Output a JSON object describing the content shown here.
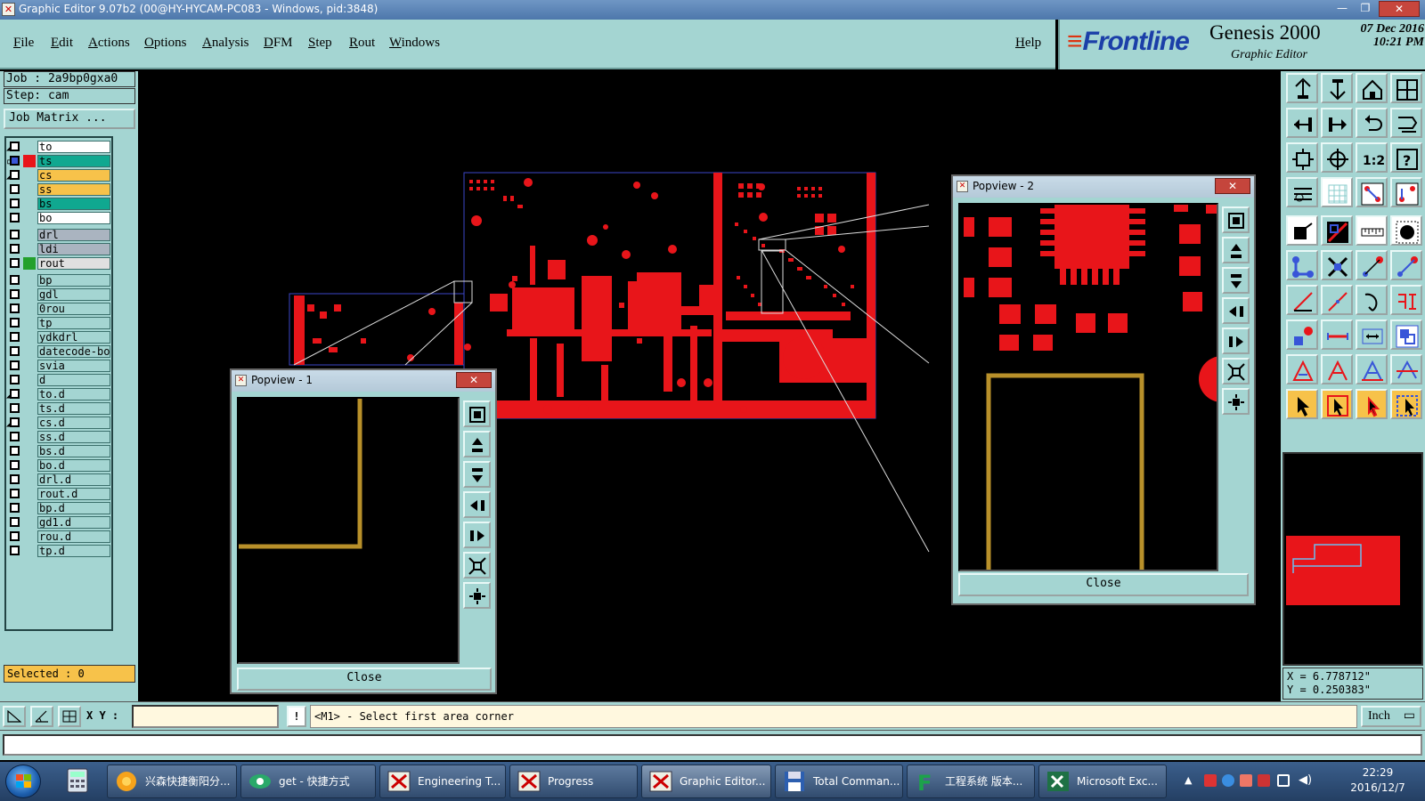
{
  "window": {
    "title": "Graphic Editor 9.07b2 (00@HY-HYCAM-PC083 - Windows, pid:3848)",
    "min": "—",
    "max": "❐",
    "close": "✕"
  },
  "menu": {
    "items": [
      "File",
      "Edit",
      "Actions",
      "Options",
      "Analysis",
      "DFM",
      "Step",
      "Rout",
      "Windows"
    ],
    "help": "Help"
  },
  "brand": {
    "logo": "Frontline",
    "product": "Genesis 2000",
    "subtitle": "Graphic Editor",
    "date": "07 Dec 2016",
    "time": "10:21 PM"
  },
  "left": {
    "job": "Job : 2a9bp0gxa0",
    "step": "Step: cam",
    "job_matrix": "Job Matrix ...",
    "selected": "Selected : 0",
    "layers": [
      {
        "name": "to",
        "bg": "#ffffff",
        "swatch": "",
        "mark": "◢",
        "checked": false
      },
      {
        "name": "ts",
        "bg": "#10a890",
        "swatch": "#e8151a",
        "mark": "▫",
        "checked": true
      },
      {
        "name": "cs",
        "bg": "#f7c24a",
        "swatch": "",
        "mark": "◢",
        "checked": false
      },
      {
        "name": "ss",
        "bg": "#f7c24a",
        "swatch": "",
        "mark": "",
        "checked": false
      },
      {
        "name": "bs",
        "bg": "#10a890",
        "swatch": "",
        "mark": "",
        "checked": false
      },
      {
        "name": "bo",
        "bg": "#ffffff",
        "swatch": "",
        "mark": "",
        "checked": false
      },
      {
        "name": "drl",
        "bg": "#aab4c0",
        "swatch": "",
        "mark": "",
        "checked": false
      },
      {
        "name": "ldi",
        "bg": "#aab4c0",
        "swatch": "",
        "mark": "",
        "checked": false
      },
      {
        "name": "rout",
        "bg": "#e0e0e0",
        "swatch": "#23a02c",
        "mark": "",
        "checked": false
      },
      {
        "name": "bp",
        "bg": "#a4d5d2",
        "swatch": "",
        "mark": "",
        "checked": false
      },
      {
        "name": "gdl",
        "bg": "#a4d5d2",
        "swatch": "",
        "mark": "",
        "checked": false
      },
      {
        "name": "0rou",
        "bg": "#a4d5d2",
        "swatch": "",
        "mark": "",
        "checked": false
      },
      {
        "name": "tp",
        "bg": "#a4d5d2",
        "swatch": "",
        "mark": "",
        "checked": false
      },
      {
        "name": "ydkdrl",
        "bg": "#a4d5d2",
        "swatch": "",
        "mark": "",
        "checked": false
      },
      {
        "name": "datecode-bo",
        "bg": "#a4d5d2",
        "swatch": "",
        "mark": "",
        "checked": false
      },
      {
        "name": "svia",
        "bg": "#a4d5d2",
        "swatch": "",
        "mark": "",
        "checked": false
      },
      {
        "name": "d",
        "bg": "#a4d5d2",
        "swatch": "",
        "mark": "",
        "checked": false
      },
      {
        "name": "to.d",
        "bg": "#a4d5d2",
        "swatch": "",
        "mark": "◢",
        "checked": false
      },
      {
        "name": "ts.d",
        "bg": "#a4d5d2",
        "swatch": "",
        "mark": "",
        "checked": false
      },
      {
        "name": "cs.d",
        "bg": "#a4d5d2",
        "swatch": "",
        "mark": "◢",
        "checked": false
      },
      {
        "name": "ss.d",
        "bg": "#a4d5d2",
        "swatch": "",
        "mark": "",
        "checked": false
      },
      {
        "name": "bs.d",
        "bg": "#a4d5d2",
        "swatch": "",
        "mark": "",
        "checked": false
      },
      {
        "name": "bo.d",
        "bg": "#a4d5d2",
        "swatch": "",
        "mark": "",
        "checked": false
      },
      {
        "name": "drl.d",
        "bg": "#a4d5d2",
        "swatch": "",
        "mark": "",
        "checked": false
      },
      {
        "name": "rout.d",
        "bg": "#a4d5d2",
        "swatch": "",
        "mark": "",
        "checked": false
      },
      {
        "name": "bp.d",
        "bg": "#a4d5d2",
        "swatch": "",
        "mark": "",
        "checked": false
      },
      {
        "name": "gd1.d",
        "bg": "#a4d5d2",
        "swatch": "",
        "mark": "",
        "checked": false
      },
      {
        "name": "rou.d",
        "bg": "#a4d5d2",
        "swatch": "",
        "mark": "",
        "checked": false
      },
      {
        "name": "tp.d",
        "bg": "#a4d5d2",
        "swatch": "",
        "mark": "",
        "checked": false
      }
    ]
  },
  "popview1": {
    "title": "Popview - 1",
    "close_x": "✕",
    "close_button": "Close"
  },
  "popview2": {
    "title": "Popview - 2",
    "close_x": "✕",
    "close_button": "Close"
  },
  "coords": {
    "x": "X = 6.778712\"",
    "y": "Y = 0.250383\""
  },
  "status": {
    "xy_label": "X Y :",
    "xy_value": "",
    "bang": "!",
    "prompt": "<M1> - Select first area corner",
    "unit": "Inch",
    "unit_arrow": "▭"
  },
  "taskbar": {
    "items": [
      {
        "label": "兴森快捷衡阳分...",
        "icon": "folder-icon"
      },
      {
        "label": "get - 快捷方式",
        "icon": "eye-icon"
      },
      {
        "label": "Engineering T...",
        "icon": "graphic-editor-icon"
      },
      {
        "label": "Progress",
        "icon": "graphic-editor-icon"
      },
      {
        "label": "Graphic Editor...",
        "icon": "graphic-editor-icon"
      },
      {
        "label": "Total Comman...",
        "icon": "floppy-icon"
      },
      {
        "label": "工程系统  版本...",
        "icon": "app-f-icon"
      },
      {
        "label": "Microsoft Exc...",
        "icon": "excel-icon"
      }
    ],
    "time": "22:29",
    "date": "2016/12/7"
  },
  "colors": {
    "panel": "#a4d5d2",
    "copper": "#e8151a",
    "outline": "#b8902a",
    "highlight": "#f7c24a"
  }
}
